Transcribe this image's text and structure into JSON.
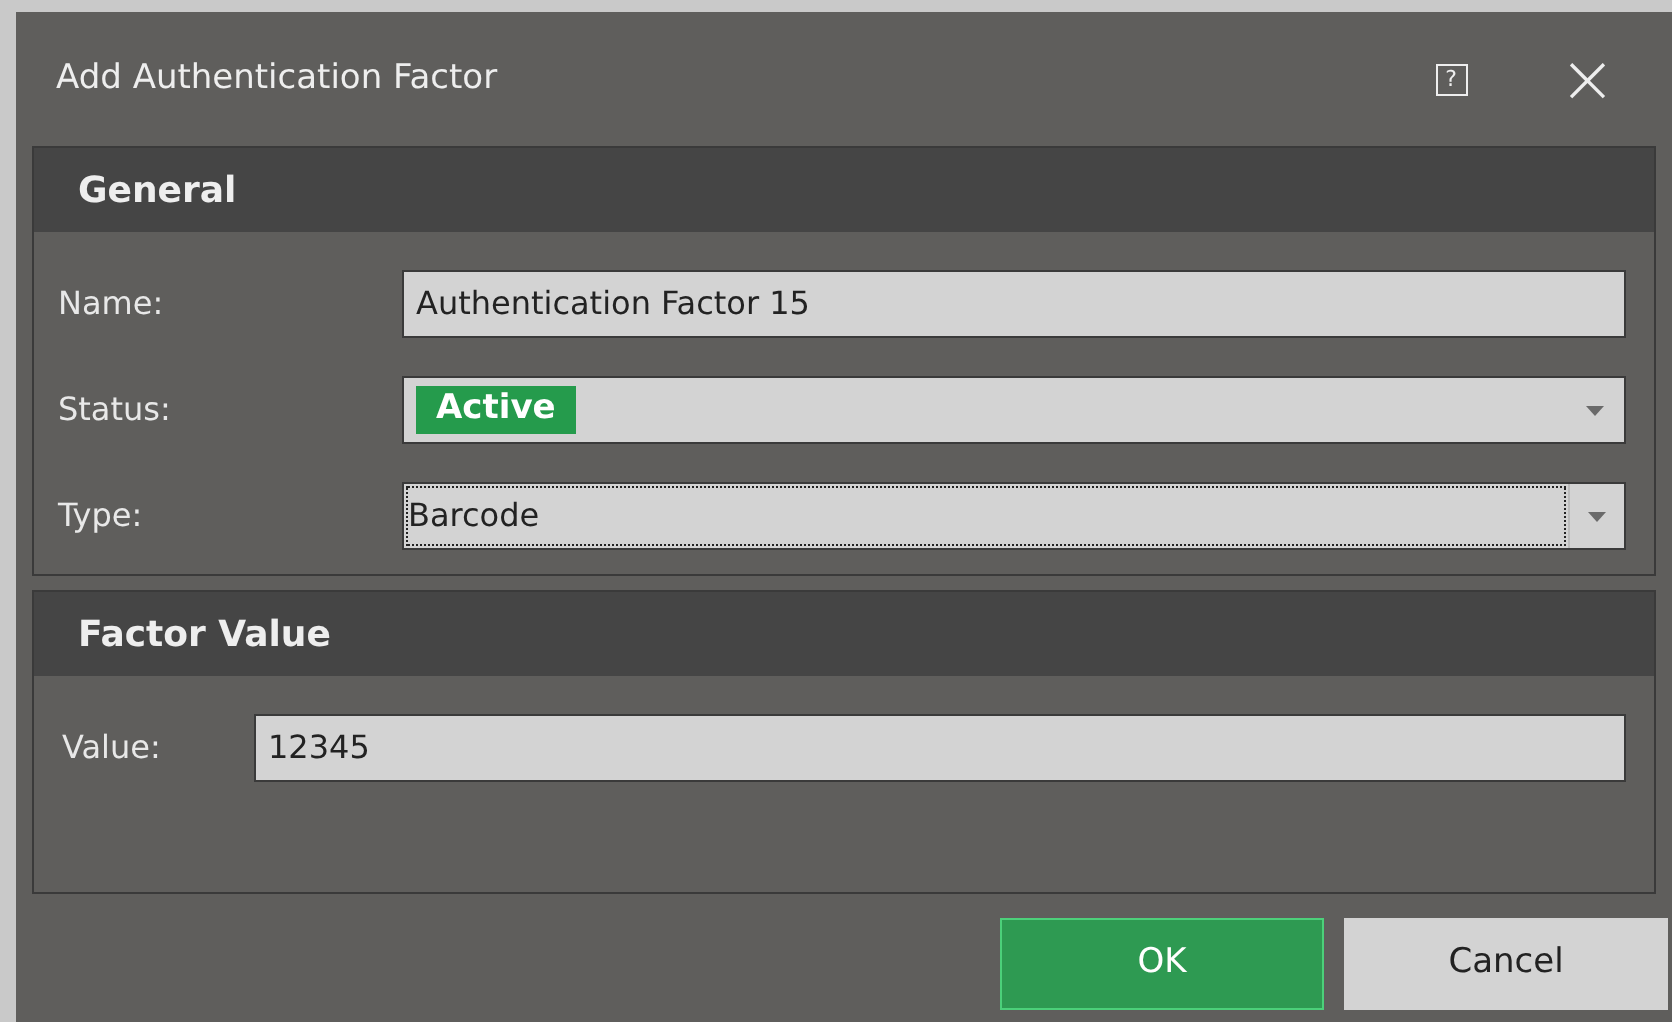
{
  "window": {
    "title": "Add Authentication Factor",
    "help_button": "?",
    "close_button": "×"
  },
  "sections": [
    {
      "title": "General",
      "fields": [
        {
          "kind": "text",
          "label": "Name:",
          "value": "Authentication Factor 15",
          "focused": false
        },
        {
          "kind": "badge-select",
          "label": "Status:",
          "value": "Active",
          "color": "#259b4c",
          "focused": false
        },
        {
          "kind": "select",
          "label": "Type:",
          "value": "Barcode",
          "focused": true
        }
      ]
    },
    {
      "title": "Factor Value",
      "fields": [
        {
          "kind": "text",
          "label": "Value:",
          "value": "12345",
          "focused": false
        }
      ]
    }
  ],
  "buttons": [
    {
      "label": "OK",
      "kind": "primary"
    },
    {
      "label": "Cancel",
      "kind": "secondary"
    }
  ]
}
